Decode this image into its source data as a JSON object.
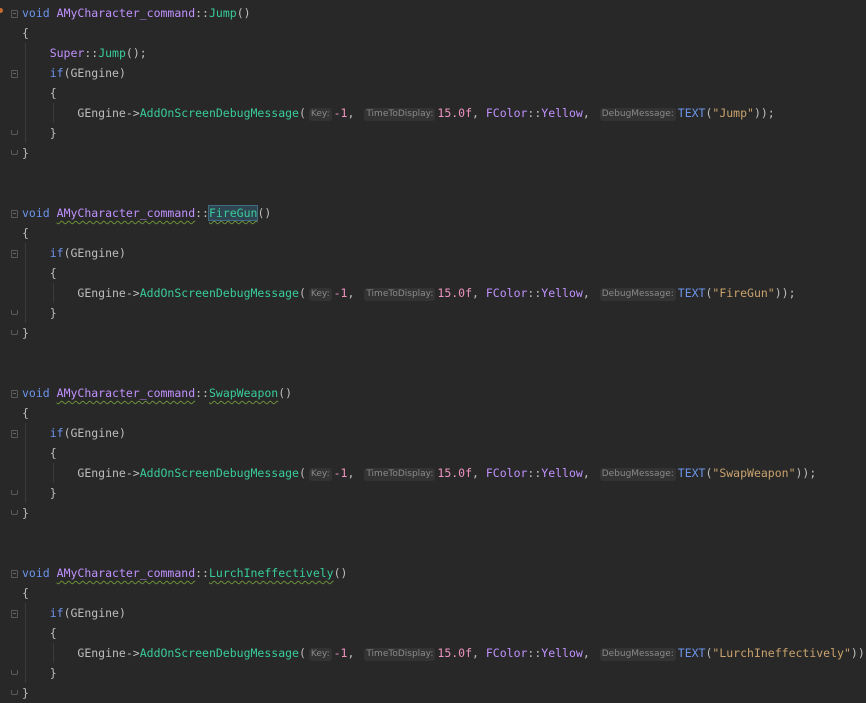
{
  "colors": {
    "background": "#282828",
    "keyword": "#6c95eb",
    "class": "#c191ff",
    "function": "#39cc9b",
    "number": "#ed94c0",
    "string": "#c9a26d"
  },
  "code": {
    "kw_void": "void",
    "class_name": "AMyCharacter_command",
    "scope": "::",
    "kw_if": "if",
    "gengine": "GEngine",
    "arrow": "->",
    "debug_fn": "AddOnScreenDebugMessage",
    "hint_key": "Key:",
    "key_val": "-1",
    "hint_time": "TimeToDisplay:",
    "time_val": "15.0f",
    "fcolor": "FColor",
    "yellow": "Yellow",
    "hint_msg": "DebugMessage:",
    "text_macro": "TEXT",
    "super_kw": "Super",
    "jump_call": "Jump",
    "functions": [
      {
        "name": "Jump",
        "message": "\"Jump\""
      },
      {
        "name": "FireGun",
        "message": "\"FireGun\""
      },
      {
        "name": "SwapWeapon",
        "message": "\"SwapWeapon\""
      },
      {
        "name": "LurchIneffectively",
        "message": "\"LurchIneffectively\""
      }
    ]
  }
}
